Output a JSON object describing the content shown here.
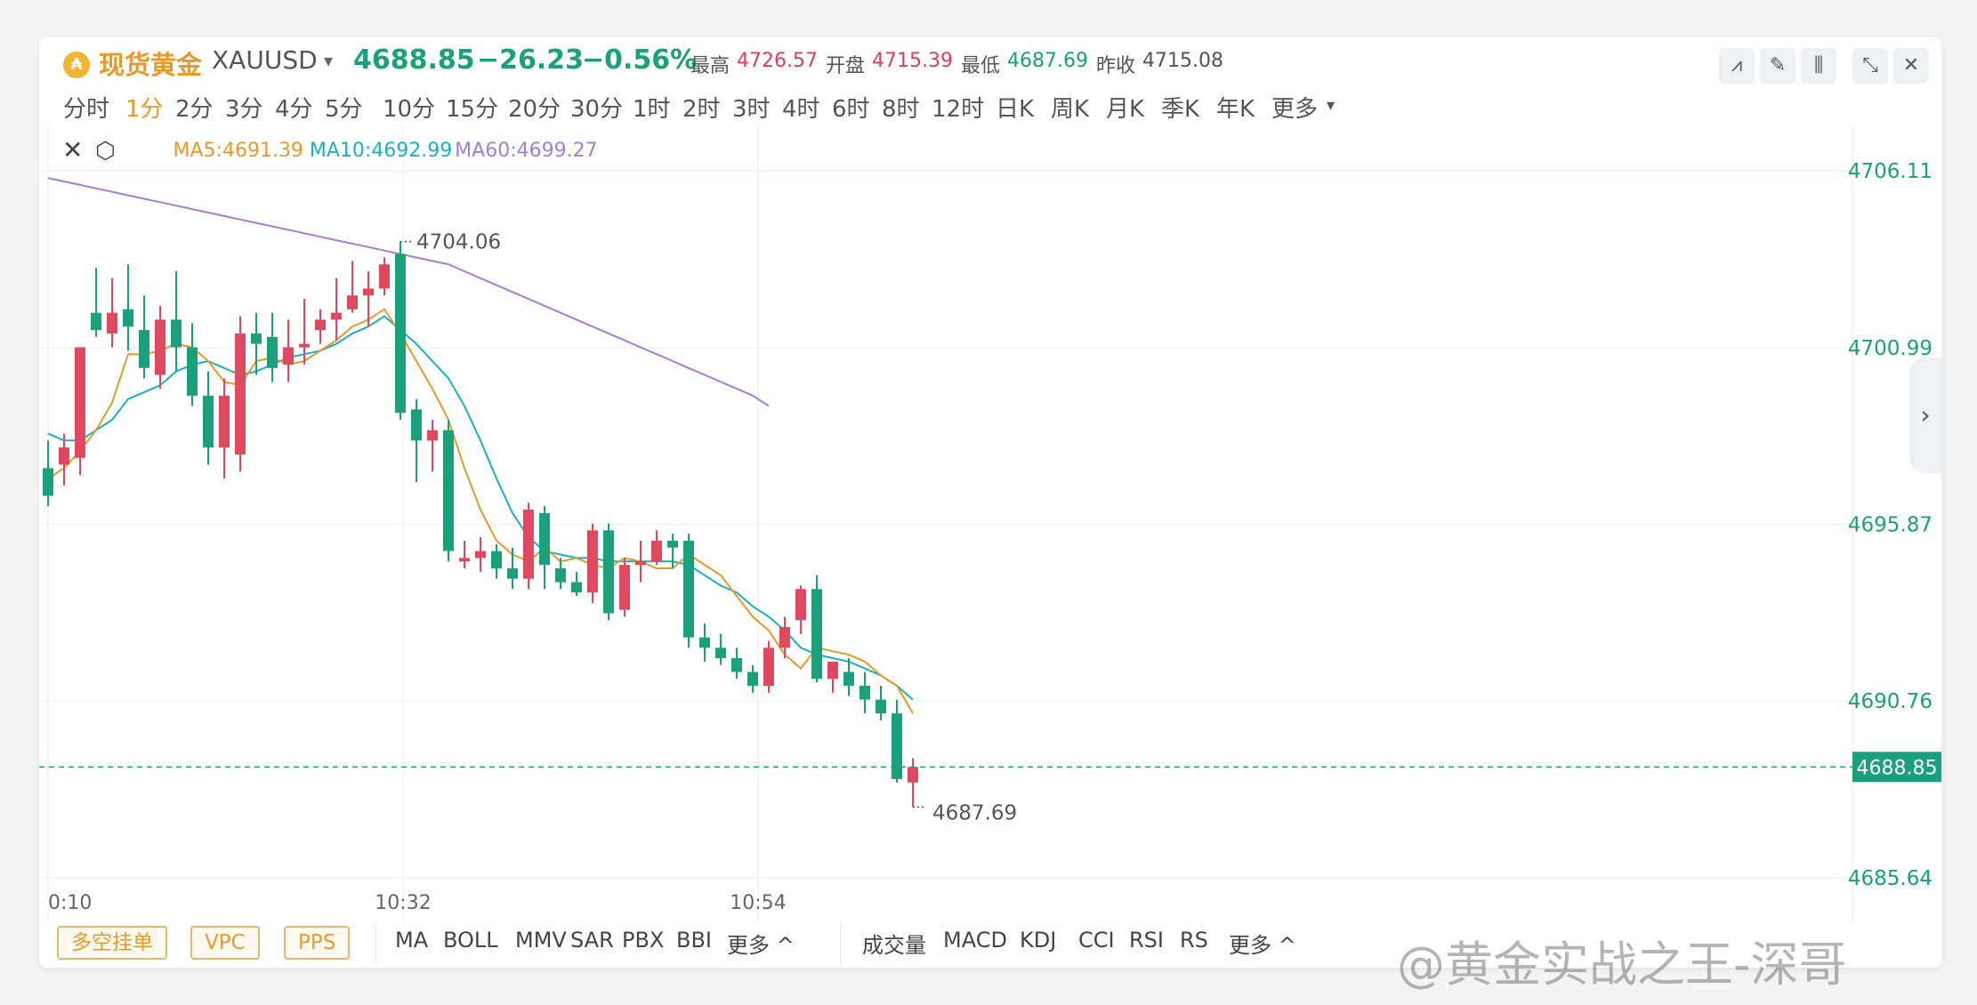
{
  "header": {
    "icon": "gold-coin-icon",
    "name": "现货黄金",
    "code": "XAUUSD",
    "last": "4688.85",
    "change": "−26.23",
    "change_pct": "−0.56%",
    "stats": [
      {
        "label": "最高",
        "value": "4726.57",
        "tone": "up"
      },
      {
        "label": "开盘",
        "value": "4715.39",
        "tone": "up"
      },
      {
        "label": "最低",
        "value": "4687.69",
        "tone": "down"
      },
      {
        "label": "昨收",
        "value": "4715.08",
        "tone": "neutral"
      }
    ]
  },
  "toolbar": {
    "icons": [
      "line-draw-icon",
      "pencil-icon",
      "candle-style-icon",
      "collapse-icon",
      "close-icon"
    ]
  },
  "periods": [
    "分时",
    "1分",
    "2分",
    "3分",
    "4分",
    "5分",
    "10分",
    "15分",
    "20分",
    "30分",
    "1时",
    "2时",
    "3时",
    "4时",
    "6时",
    "8时",
    "12时",
    "日K",
    "周K",
    "月K",
    "季K",
    "年K",
    "更多"
  ],
  "active_period": "1分",
  "ma_legend": [
    {
      "label": "MA5:4691.39",
      "color": "#e89a29"
    },
    {
      "label": "MA10:4692.99",
      "color": "#17b2c1"
    },
    {
      "label": "MA60:4699.27",
      "color": "#a47fd6"
    }
  ],
  "annotations": {
    "high": "4704.06",
    "low": "4687.69"
  },
  "current_price_label": "4688.85",
  "colors": {
    "up": "#e0485f",
    "down": "#1aa17c",
    "ma5": "#e89a29",
    "ma10": "#17b2c1",
    "ma60": "#a47fd6"
  },
  "indicators": {
    "left_buttons": [
      "多空挂单",
      "VPC",
      "PPS"
    ],
    "main": [
      "MA",
      "BOLL",
      "MMV",
      "SAR",
      "PBX",
      "BBI",
      "更多 ^"
    ],
    "sub": [
      "成交量",
      "MACD",
      "KDJ",
      "CCI",
      "RSI",
      "RS",
      "更多 ^"
    ]
  },
  "watermark": "@黄金实战之王-深哥",
  "chart_data": {
    "type": "candlestick",
    "y_ticks": [
      "4706.11",
      "4700.99",
      "4695.87",
      "4690.76",
      "4685.64"
    ],
    "ylim": [
      4685.64,
      4706.11
    ],
    "x_ticks": [
      "0:10",
      "10:32",
      "10:54"
    ],
    "candles": [
      {
        "o": 4697.5,
        "h": 4698.3,
        "c": 4696.7,
        "l": 4696.4
      },
      {
        "o": 4697.6,
        "h": 4698.5,
        "c": 4698.1,
        "l": 4697.0
      },
      {
        "o": 4697.8,
        "h": 4700.3,
        "c": 4701.0,
        "l": 4697.3
      },
      {
        "o": 4702.0,
        "h": 4703.3,
        "c": 4701.5,
        "l": 4701.3
      },
      {
        "o": 4701.4,
        "h": 4703.0,
        "c": 4702.0,
        "l": 4701.0
      },
      {
        "o": 4702.1,
        "h": 4703.4,
        "c": 4701.6,
        "l": 4700.9
      },
      {
        "o": 4701.5,
        "h": 4702.5,
        "c": 4700.4,
        "l": 4700.1
      },
      {
        "o": 4700.2,
        "h": 4702.2,
        "c": 4701.8,
        "l": 4699.8
      },
      {
        "o": 4701.8,
        "h": 4703.2,
        "c": 4701.0,
        "l": 4700.3
      },
      {
        "o": 4701.0,
        "h": 4701.7,
        "c": 4699.6,
        "l": 4699.3
      },
      {
        "o": 4699.6,
        "h": 4700.3,
        "c": 4698.1,
        "l": 4697.6
      },
      {
        "o": 4698.1,
        "h": 4700.1,
        "c": 4699.6,
        "l": 4697.2
      },
      {
        "o": 4697.9,
        "h": 4701.9,
        "c": 4701.4,
        "l": 4697.4
      },
      {
        "o": 4701.4,
        "h": 4702.0,
        "c": 4701.1,
        "l": 4700.2
      },
      {
        "o": 4701.3,
        "h": 4702.0,
        "c": 4700.4,
        "l": 4700.0
      },
      {
        "o": 4700.5,
        "h": 4701.8,
        "c": 4701.0,
        "l": 4700.0
      },
      {
        "o": 4701.0,
        "h": 4702.4,
        "c": 4701.1,
        "l": 4700.5
      },
      {
        "o": 4701.5,
        "h": 4702.1,
        "c": 4701.8,
        "l": 4701.1
      },
      {
        "o": 4701.8,
        "h": 4703.0,
        "c": 4702.0,
        "l": 4701.2
      },
      {
        "o": 4702.1,
        "h": 4703.5,
        "c": 4702.5,
        "l": 4702.0
      },
      {
        "o": 4702.5,
        "h": 4703.2,
        "c": 4702.7,
        "l": 4701.6
      },
      {
        "o": 4702.7,
        "h": 4703.6,
        "c": 4703.4,
        "l": 4702.5
      },
      {
        "o": 4703.7,
        "h": 4704.06,
        "c": 4699.1,
        "l": 4698.9
      },
      {
        "o": 4699.2,
        "h": 4699.5,
        "c": 4698.3,
        "l": 4697.1
      },
      {
        "o": 4698.3,
        "h": 4698.9,
        "c": 4698.6,
        "l": 4697.4
      },
      {
        "o": 4698.6,
        "h": 4698.9,
        "c": 4695.1,
        "l": 4694.8
      },
      {
        "o": 4694.8,
        "h": 4695.4,
        "c": 4694.9,
        "l": 4694.6
      },
      {
        "o": 4694.9,
        "h": 4695.5,
        "c": 4695.1,
        "l": 4694.5
      },
      {
        "o": 4695.1,
        "h": 4695.3,
        "c": 4694.6,
        "l": 4694.3
      },
      {
        "o": 4694.6,
        "h": 4695.2,
        "c": 4694.3,
        "l": 4694.0
      },
      {
        "o": 4694.3,
        "h": 4696.5,
        "c": 4696.3,
        "l": 4694.0
      },
      {
        "o": 4696.2,
        "h": 4696.4,
        "c": 4694.7,
        "l": 4694.0
      },
      {
        "o": 4694.6,
        "h": 4694.9,
        "c": 4694.2,
        "l": 4694.0
      },
      {
        "o": 4694.2,
        "h": 4694.5,
        "c": 4693.9,
        "l": 4693.8
      },
      {
        "o": 4693.9,
        "h": 4695.9,
        "c": 4695.7,
        "l": 4693.6
      },
      {
        "o": 4695.7,
        "h": 4695.9,
        "c": 4693.3,
        "l": 4693.1
      },
      {
        "o": 4693.4,
        "h": 4694.9,
        "c": 4694.7,
        "l": 4693.2
      },
      {
        "o": 4694.7,
        "h": 4695.4,
        "c": 4694.8,
        "l": 4694.2
      },
      {
        "o": 4694.8,
        "h": 4695.7,
        "c": 4695.4,
        "l": 4694.7
      },
      {
        "o": 4695.4,
        "h": 4695.6,
        "c": 4695.2,
        "l": 4694.6
      },
      {
        "o": 4695.4,
        "h": 4695.6,
        "c": 4692.6,
        "l": 4692.3
      },
      {
        "o": 4692.6,
        "h": 4693.0,
        "c": 4692.3,
        "l": 4691.9
      },
      {
        "o": 4692.3,
        "h": 4692.7,
        "c": 4692.0,
        "l": 4691.8
      },
      {
        "o": 4692.0,
        "h": 4692.3,
        "c": 4691.6,
        "l": 4691.4
      },
      {
        "o": 4691.6,
        "h": 4691.8,
        "c": 4691.2,
        "l": 4691.0
      },
      {
        "o": 4691.2,
        "h": 4692.5,
        "c": 4692.3,
        "l": 4691.0
      },
      {
        "o": 4692.3,
        "h": 4693.2,
        "c": 4692.9,
        "l": 4692.0
      },
      {
        "o": 4693.1,
        "h": 4694.1,
        "c": 4694.0,
        "l": 4692.7
      },
      {
        "o": 4694.0,
        "h": 4694.4,
        "c": 4691.4,
        "l": 4691.3
      },
      {
        "o": 4691.4,
        "h": 4691.8,
        "c": 4691.9,
        "l": 4691.0
      },
      {
        "o": 4691.6,
        "h": 4692.0,
        "c": 4691.2,
        "l": 4690.9
      },
      {
        "o": 4691.2,
        "h": 4691.6,
        "c": 4690.8,
        "l": 4690.4
      },
      {
        "o": 4690.8,
        "h": 4691.2,
        "c": 4690.4,
        "l": 4690.2
      },
      {
        "o": 4690.4,
        "h": 4690.8,
        "c": 4688.5,
        "l": 4688.4
      },
      {
        "o": 4688.4,
        "h": 4689.1,
        "c": 4688.85,
        "l": 4687.69
      }
    ],
    "ma5": [
      4697.2,
      4697.5,
      4698.0,
      4698.6,
      4699.4,
      4700.8,
      4700.8,
      4700.9,
      4701.1,
      4701.0,
      4700.6,
      4700.0,
      4699.9,
      4700.6,
      4700.7,
      4700.5,
      4700.6,
      4700.9,
      4701.2,
      4701.6,
      4701.8,
      4702.1,
      4701.4,
      4700.6,
      4699.8,
      4698.9,
      4697.5,
      4696.3,
      4695.4,
      4695.0,
      4694.8,
      4695.2,
      4694.8,
      4694.9,
      4694.7,
      4694.6,
      4694.9,
      4694.8,
      4694.6,
      4694.6,
      4695.0,
      4694.7,
      4694.4,
      4693.8,
      4693.2,
      4692.8,
      4692.1,
      4691.7,
      4692.3,
      4692.2,
      4692.1,
      4691.9,
      4691.5,
      4691.2,
      4690.4
    ],
    "ma10": [
      4698.5,
      4698.3,
      4698.3,
      4698.6,
      4698.9,
      4699.5,
      4699.7,
      4699.9,
      4700.3,
      4700.5,
      4700.6,
      4700.4,
      4700.2,
      4700.3,
      4700.5,
      4700.7,
      4700.8,
      4700.9,
      4701.1,
      4701.4,
      4701.6,
      4701.9,
      4701.5,
      4701.1,
      4700.6,
      4700.1,
      4699.3,
      4698.3,
      4697.2,
      4696.2,
      4695.5,
      4695.1,
      4695.0,
      4694.9,
      4694.9,
      4694.8,
      4694.8,
      4694.8,
      4694.8,
      4694.8,
      4694.7,
      4694.4,
      4694.1,
      4693.9,
      4693.5,
      4693.2,
      4692.8,
      4692.3,
      4692.1,
      4692.0,
      4691.9,
      4691.7,
      4691.5,
      4691.2,
      4690.8
    ],
    "ma60": [
      4705.9,
      4705.8,
      4705.7,
      4705.6,
      4705.5,
      4705.4,
      4705.3,
      4705.2,
      4705.1,
      4705.0,
      4704.9,
      4704.8,
      4704.7,
      4704.6,
      4704.5,
      4704.4,
      4704.3,
      4704.2,
      4704.1,
      4704.0,
      4703.9,
      4703.8,
      4703.7,
      4703.6,
      4703.5,
      4703.4,
      4703.2,
      4703.0,
      4702.8,
      4702.6,
      4702.4,
      4702.2,
      4702.0,
      4701.8,
      4701.6,
      4701.4,
      4701.2,
      4701.0,
      4700.8,
      4700.6,
      4700.4,
      4700.2,
      4700.0,
      4699.8,
      4699.6,
      4699.3
    ]
  }
}
